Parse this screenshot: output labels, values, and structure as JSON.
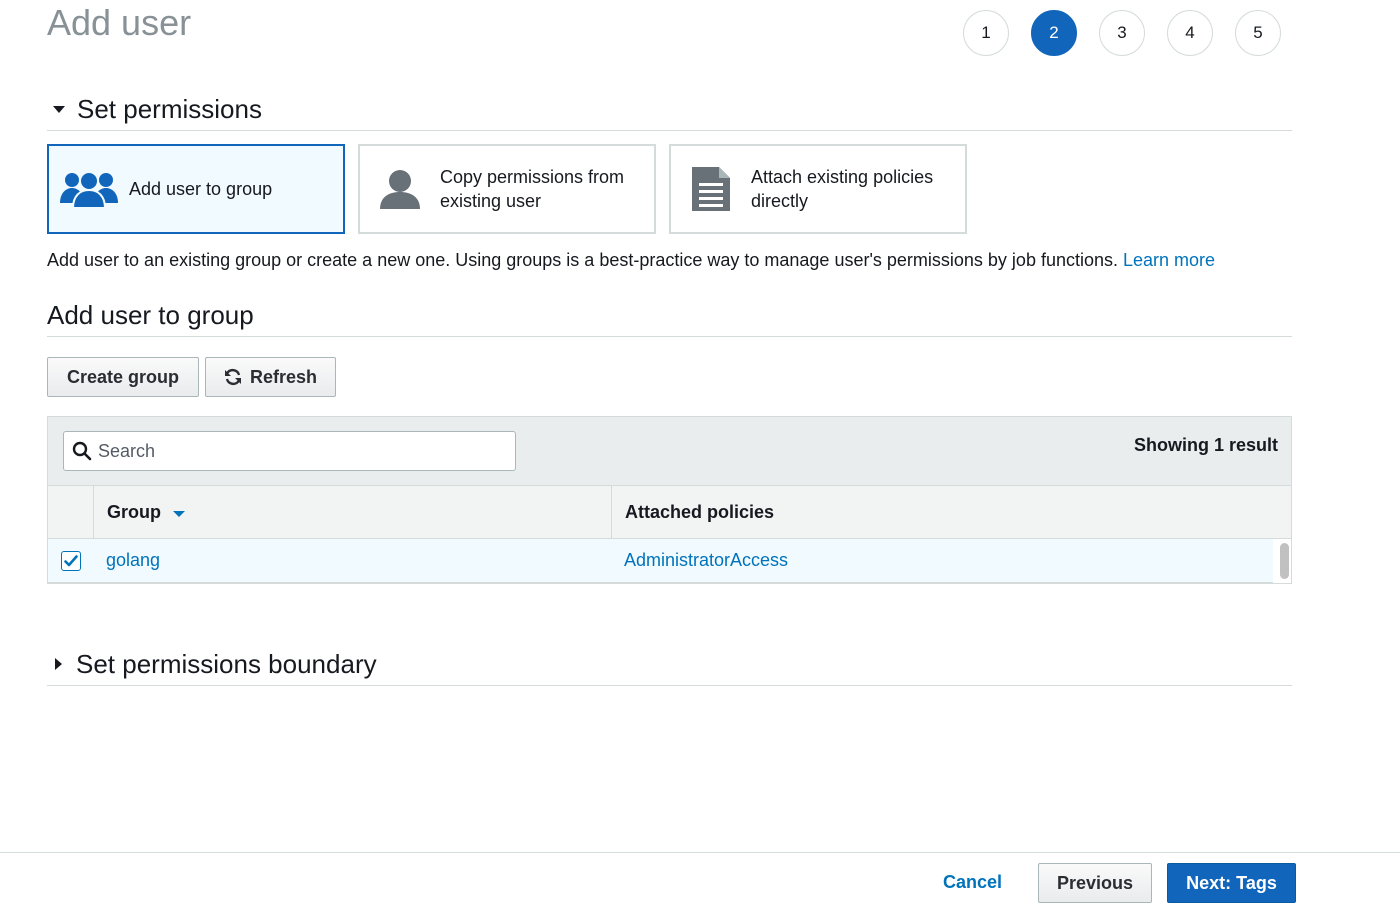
{
  "header": {
    "title": "Add user",
    "steps": [
      "1",
      "2",
      "3",
      "4",
      "5"
    ],
    "active_step": "2"
  },
  "permissions": {
    "section_title": "Set permissions",
    "options": [
      {
        "label_line1": "Add user to group",
        "label_line2": "",
        "icon": "users-group-icon",
        "selected": true
      },
      {
        "label_line1": "Copy permissions from",
        "label_line2": "existing user",
        "icon": "user-icon",
        "selected": false
      },
      {
        "label_line1": "Attach existing policies",
        "label_line2": "directly",
        "icon": "document-icon",
        "selected": false
      }
    ],
    "description": "Add user to an existing group or create a new one. Using groups is a best-practice way to manage user's permissions by job functions.",
    "learn_more": "Learn more"
  },
  "group_section": {
    "title": "Add user to group",
    "create_group_label": "Create group",
    "refresh_label": "Refresh",
    "search_placeholder": "Search",
    "result_count": "Showing 1 result",
    "columns": {
      "group": "Group",
      "policies": "Attached policies"
    },
    "rows": [
      {
        "checked": true,
        "group": "golang",
        "policies": "AdministratorAccess"
      }
    ]
  },
  "boundary": {
    "title": "Set permissions boundary"
  },
  "footer": {
    "cancel": "Cancel",
    "previous": "Previous",
    "next": "Next: Tags"
  },
  "colors": {
    "accent": "#1166bb",
    "link": "#0073bb",
    "selected_bg": "#f1faff",
    "title_gray": "#879196"
  }
}
